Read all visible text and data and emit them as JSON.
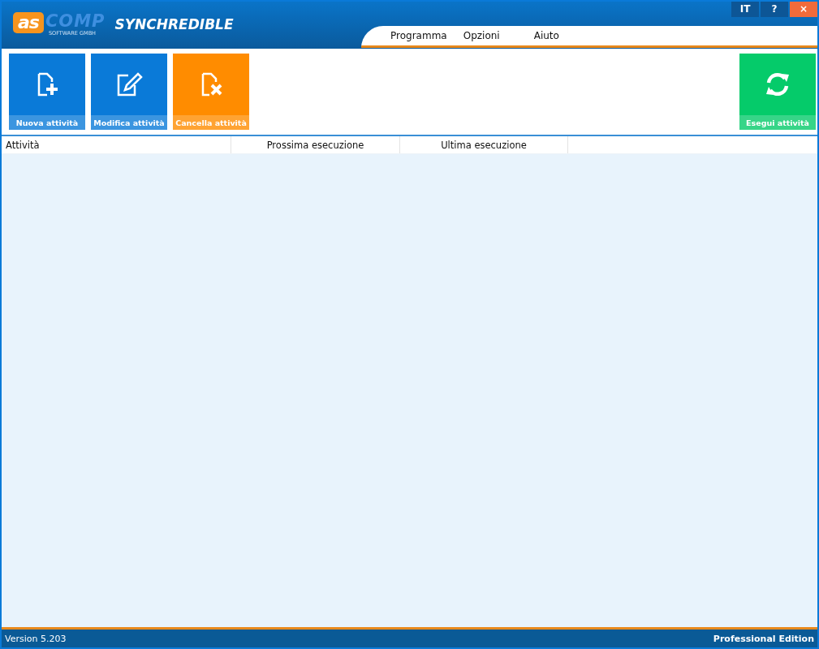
{
  "logo": {
    "mark": "as",
    "word": "COMP",
    "tagline": "SOFTWARE GMBH"
  },
  "window": {
    "title": "SYNCHREDIBLE",
    "controls": [
      {
        "label": "IT",
        "kind": "lang"
      },
      {
        "label": "?",
        "kind": "help"
      },
      {
        "label": "×",
        "kind": "close"
      }
    ]
  },
  "menu": [
    "Programma",
    "Opzioni",
    "Aiuto"
  ],
  "toolbar": [
    {
      "label": "Nuova attività",
      "color": "#0a7ad8"
    },
    {
      "label": "Modifica attività",
      "color": "#0a7ad8"
    },
    {
      "label": "Cancella attività",
      "color": "#ff8c00"
    },
    {
      "label": "Esegui attività",
      "color": "#05cb6a"
    }
  ],
  "table": {
    "columns": [
      {
        "label": "Attività"
      },
      {
        "label": "Prossima esecuzione"
      },
      {
        "label": "Ultima esecuzione"
      }
    ]
  },
  "status_bar": {
    "version": "Version 5.203",
    "edition": "Professional Edition"
  }
}
